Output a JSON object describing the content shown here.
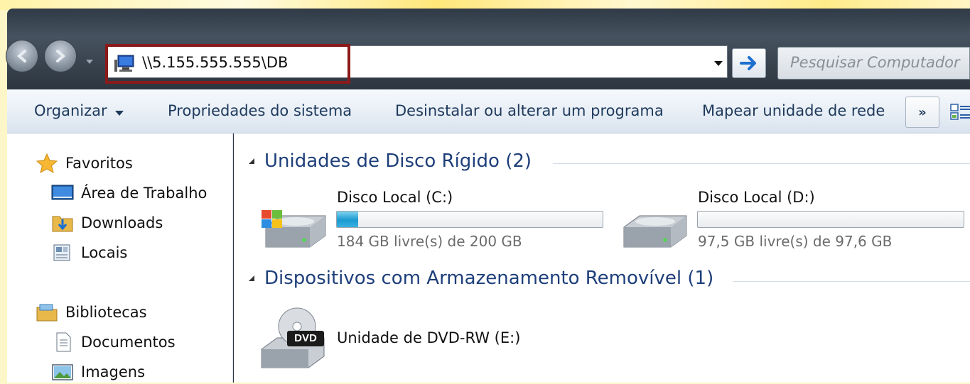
{
  "address": {
    "path": "\\\\5.155.555.555\\DB"
  },
  "search": {
    "placeholder": "Pesquisar Computador"
  },
  "toolbar": {
    "organize": "Organizar",
    "system_properties": "Propriedades do sistema",
    "uninstall": "Desinstalar ou alterar um programa",
    "map_drive": "Mapear unidade de rede",
    "more": "»"
  },
  "nav": {
    "favorites": {
      "label": "Favoritos",
      "items": [
        {
          "label": "Área de Trabalho",
          "icon": "desktop-icon"
        },
        {
          "label": "Downloads",
          "icon": "downloads-folder-icon"
        },
        {
          "label": "Locais",
          "icon": "recent-places-icon"
        }
      ]
    },
    "libraries": {
      "label": "Bibliotecas",
      "items": [
        {
          "label": "Documentos",
          "icon": "documents-icon"
        },
        {
          "label": "Imagens",
          "icon": "pictures-icon"
        }
      ]
    }
  },
  "groups": {
    "hard_drives": {
      "title": "Unidades de Disco Rígido (2)",
      "drives": [
        {
          "label": "Disco Local (C:)",
          "free_text": "184 GB livre(s) de 200 GB",
          "used_fraction": 0.08,
          "icon": "windows-drive-icon"
        },
        {
          "label": "Disco Local (D:)",
          "free_text": "97,5 GB livre(s) de 97,6 GB",
          "used_fraction": 0.001,
          "icon": "hard-drive-icon"
        }
      ]
    },
    "removable": {
      "title": "Dispositivos com Armazenamento Removível (1)",
      "devices": [
        {
          "label": "Unidade de DVD-RW (E:)",
          "icon": "dvd-drive-icon",
          "icon_text": "DVD"
        }
      ]
    }
  },
  "colors": {
    "highlight_border": "#8b1a1a",
    "group_title": "#1e3f7a",
    "usage_fill": "#1a9ad0"
  }
}
